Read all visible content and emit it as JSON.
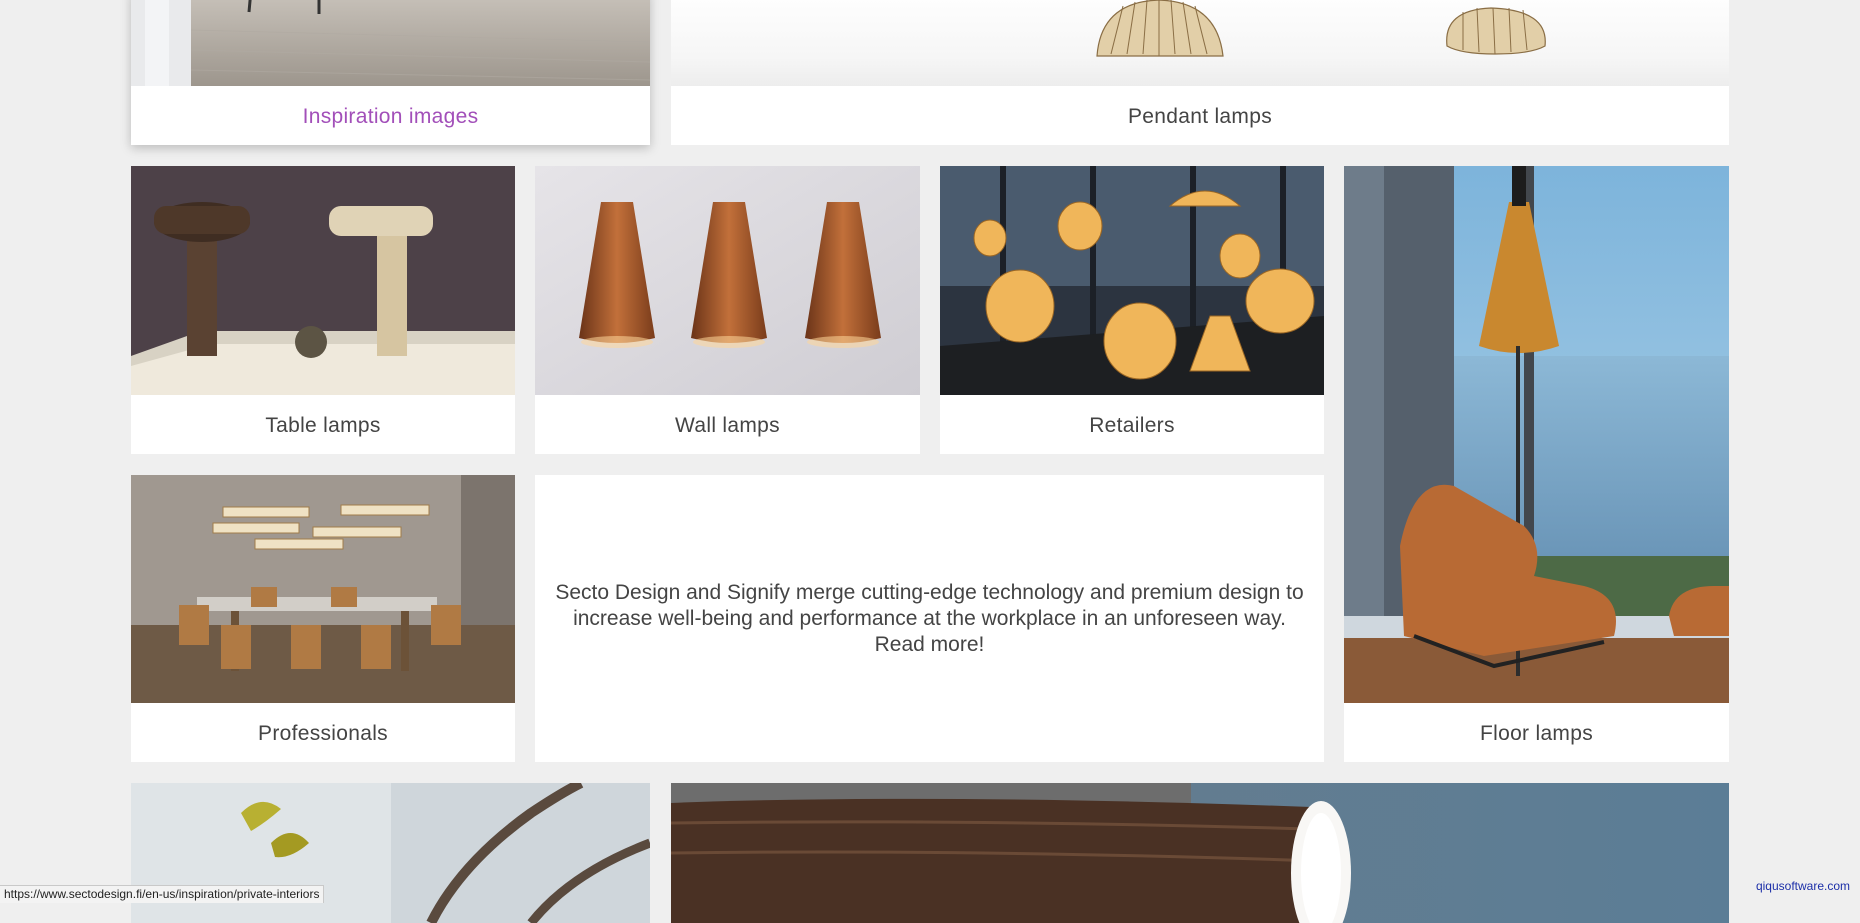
{
  "tiles": {
    "inspiration": {
      "label": "Inspiration images"
    },
    "pendant": {
      "label": "Pendant lamps"
    },
    "table": {
      "label": "Table lamps"
    },
    "wall": {
      "label": "Wall lamps"
    },
    "retailers": {
      "label": "Retailers"
    },
    "floor": {
      "label": "Floor lamps"
    },
    "professionals": {
      "label": "Professionals"
    }
  },
  "promo": {
    "text": "Secto Design and Signify merge cutting-edge technology and premium design to increase well-being and performance at the workplace in an unforeseen way. Read more!"
  },
  "status_bar": {
    "url": "https://www.sectodesign.fi/en-us/inspiration/private-interiors"
  },
  "watermark": {
    "text": "qiqusoftware.com"
  },
  "colors": {
    "page_bg": "#efefef",
    "tile_bg": "#ffffff",
    "label_text": "#444444",
    "hover_label": "#a24fb9",
    "watermark": "#1c2fa8"
  }
}
